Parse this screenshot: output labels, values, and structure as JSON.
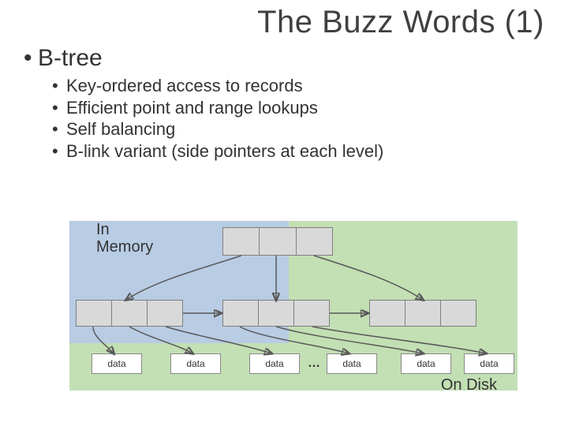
{
  "title": "The Buzz Words (1)",
  "heading": "B-tree",
  "bullets": [
    "Key-ordered access to records",
    "Efficient point and range lookups",
    "Self balancing",
    "B-link variant (side pointers at each level)"
  ],
  "diagram": {
    "region_labels": {
      "memory": "In Memory",
      "disk": "On Disk"
    },
    "leaf_label": "data",
    "ellipsis": "…",
    "root_cells": 3,
    "mid_cells": 3,
    "mid_nodes": 3,
    "leaf_count": 6
  }
}
